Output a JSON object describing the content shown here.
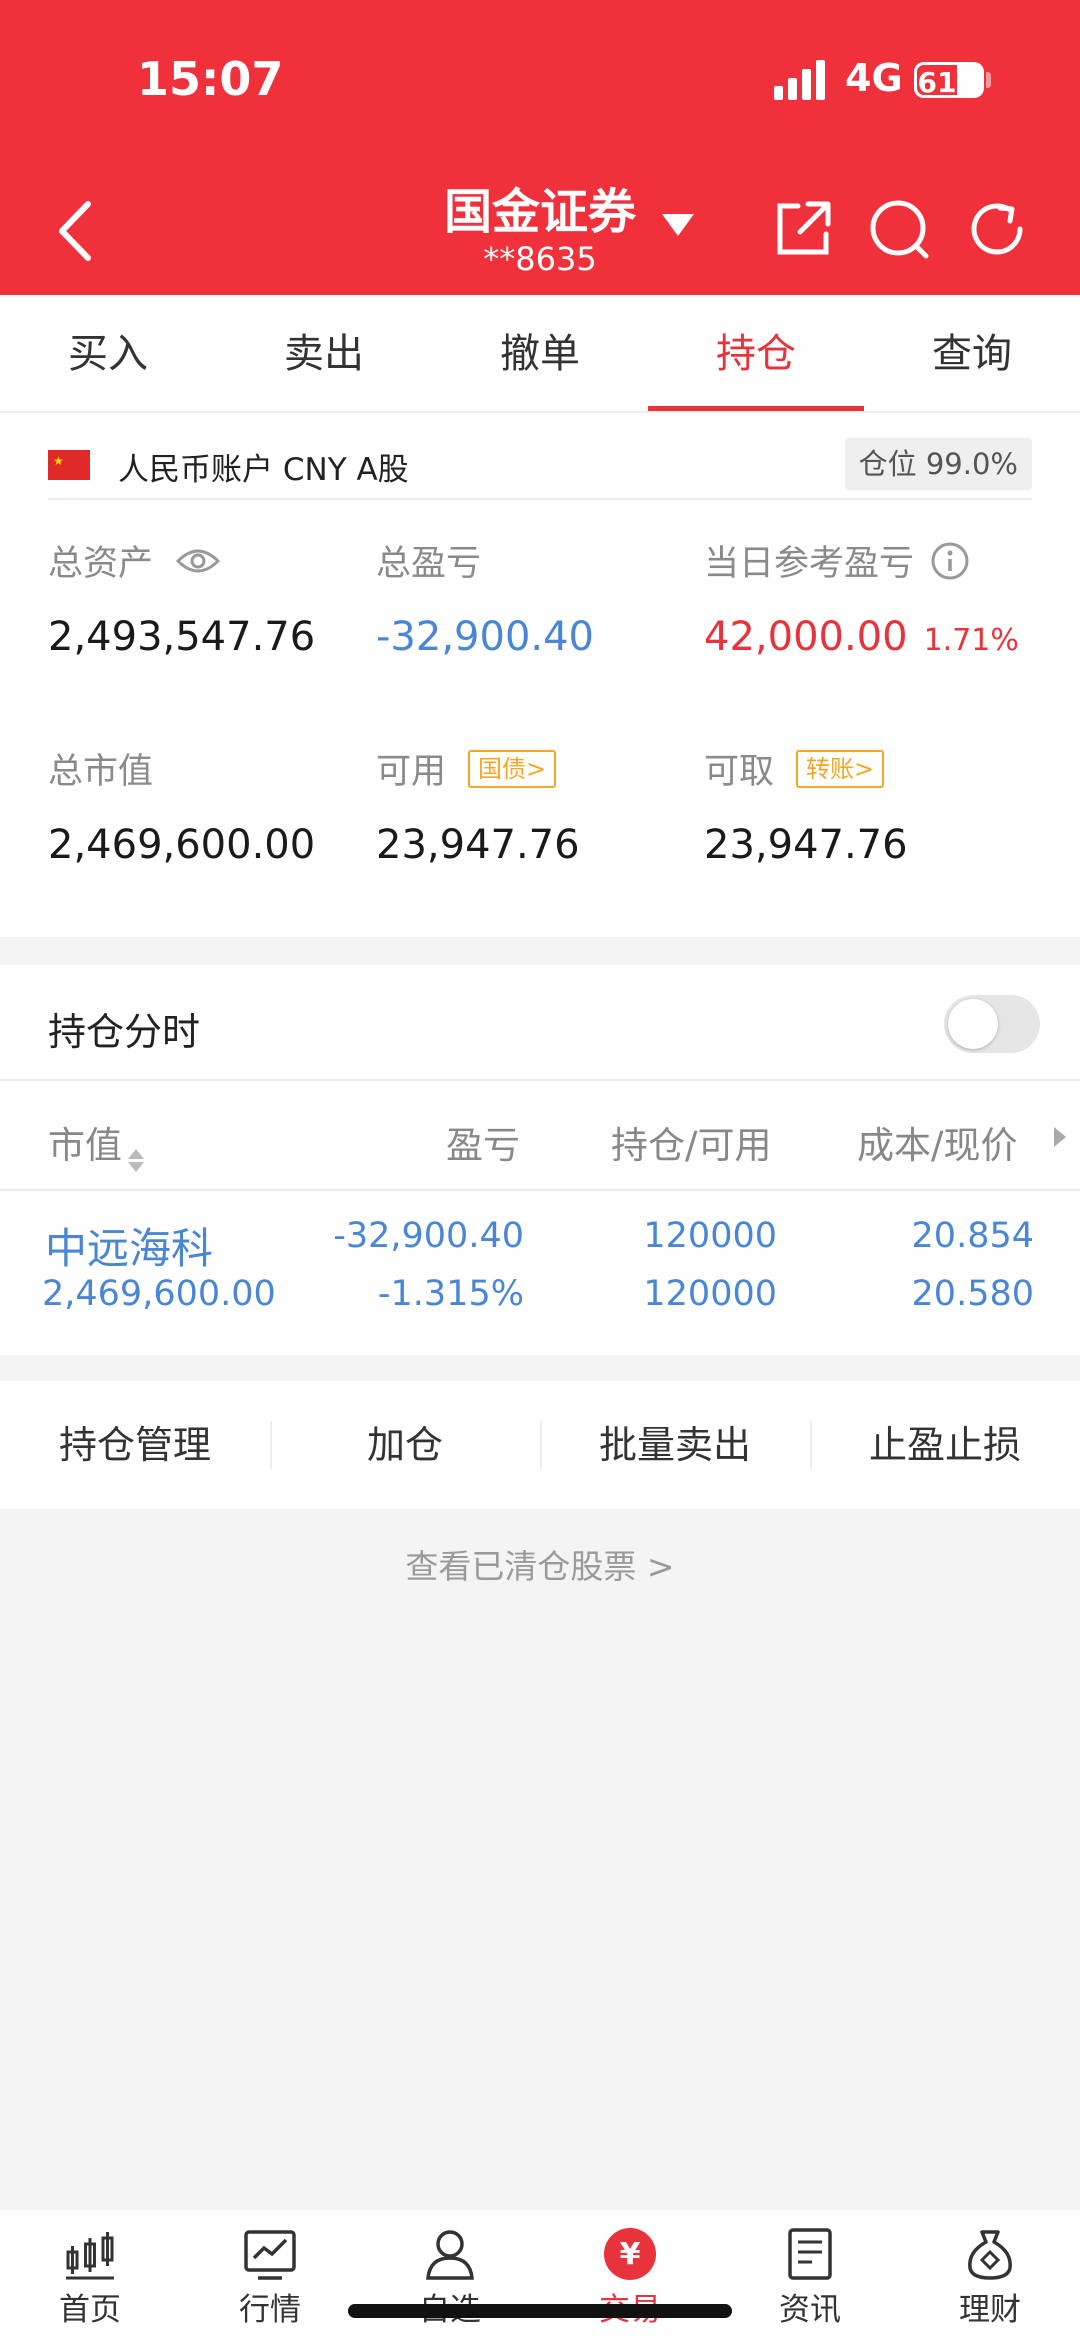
{
  "status_bar": {
    "time": "15:07",
    "network": "4G",
    "battery": "61"
  },
  "header": {
    "title": "国金证券",
    "account": "**8635",
    "icons": [
      "back-icon",
      "share-icon",
      "search-icon",
      "refresh-icon"
    ],
    "bg_color": "#f0303a"
  },
  "tabs": [
    {
      "label": "买入",
      "active": false
    },
    {
      "label": "卖出",
      "active": false
    },
    {
      "label": "撤单",
      "active": false
    },
    {
      "label": "持仓",
      "active": true
    },
    {
      "label": "查询",
      "active": false
    }
  ],
  "account": {
    "label": "人民币账户 CNY A股",
    "position_ratio": "仓位 99.0%"
  },
  "stats": {
    "total_assets": {
      "label": "总资产",
      "value": "2,493,547.76"
    },
    "total_pl": {
      "label": "总盈亏",
      "value": "-32,900.40"
    },
    "daily_pl": {
      "label": "当日参考盈亏",
      "value": "42,000.00",
      "pct": "1.71%"
    },
    "market_value": {
      "label": "总市值",
      "value": "2,469,600.00"
    },
    "available": {
      "label": "可用",
      "value": "23,947.76",
      "tag": "国债>"
    },
    "withdrawable": {
      "label": "可取",
      "value": "23,947.76",
      "tag": "转账>"
    }
  },
  "positions": {
    "title": "持仓分时",
    "toggle_on": false,
    "columns": [
      "市值",
      "盈亏",
      "持仓/可用",
      "成本/现价"
    ],
    "rows": [
      {
        "name": "中远海科",
        "market_value": "2,469,600.00",
        "pl": "-32,900.40",
        "pl_pct": "-1.315%",
        "holding": "120000",
        "available": "120000",
        "cost": "20.854",
        "price": "20.580"
      }
    ]
  },
  "actions": [
    "持仓管理",
    "加仓",
    "批量卖出",
    "止盈止损"
  ],
  "cleared_link": "查看已清仓股票 >",
  "bottom_nav": [
    {
      "label": "首页",
      "icon": "candlestick-icon"
    },
    {
      "label": "行情",
      "icon": "chart-icon"
    },
    {
      "label": "自选",
      "icon": "user-icon"
    },
    {
      "label": "交易",
      "icon": "yuan-icon",
      "active": true
    },
    {
      "label": "资讯",
      "icon": "document-icon"
    },
    {
      "label": "理财",
      "icon": "money-bag-icon"
    }
  ]
}
